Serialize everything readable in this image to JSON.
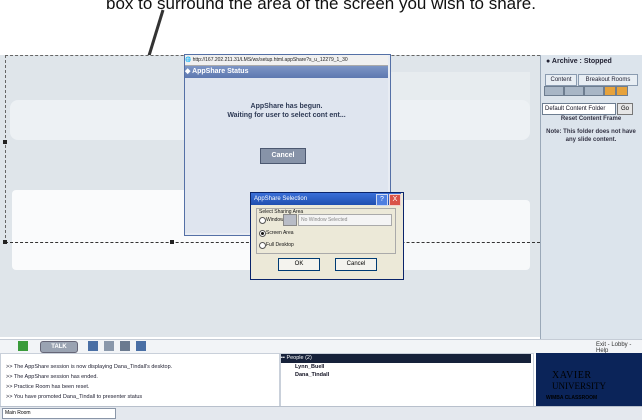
{
  "caption": "box to surround the area of the screen you wish to share.",
  "right_panel": {
    "archive_status": "Archive : Stopped",
    "tabs": [
      "Content",
      "Breakout Rooms"
    ],
    "folder_select": "Default Content Folder",
    "go_label": "Go",
    "reset_frame": "Reset Content Frame",
    "note": "Note: This folder does not have any slide content."
  },
  "popup": {
    "url": "http://167.202.211.31/LMS/ws/setup.html.appShare?s_u_12279_1_30",
    "title": "AppShare Status",
    "message_line1": "AppShare has begun.",
    "message_line2": "Waiting for user to select cont ent...",
    "cancel_label": "Cancel"
  },
  "dialog": {
    "title": "AppShare Selection",
    "help_label": "?",
    "close_label": "X",
    "group_label": "Select Sharing Area",
    "options": [
      "Window",
      "Screen Area",
      "Full Desktop"
    ],
    "selected_option": "Screen Area",
    "window_field": "No Window Selected",
    "ok_label": "OK",
    "cancel_label": "Cancel"
  },
  "toolbar": {
    "talk_label": "TALK",
    "status_right": "Exit - Lobby - Help"
  },
  "chat": {
    "lines": [
      ">> The AppShare session is now displaying Dana_Tindall's desktop.",
      ">> The AppShare session has ended.",
      ">> Practice Room has been reset.",
      ">> You have promoted Dana_Tindall to presenter status"
    ]
  },
  "people": {
    "header": "People (2)",
    "rows": [
      "Lynn_Buell",
      "Dana_Tindall"
    ]
  },
  "logo": {
    "line1": "XAVIER",
    "line2": "UNIVERSITY",
    "line3": "WIMBA CLASSROOM"
  },
  "bottom": {
    "room_select": "Main Room"
  },
  "colors": {
    "title_bar": "#5d78b0",
    "dialog_title": "#1f4fb0",
    "logo_bg": "#0b2459"
  }
}
